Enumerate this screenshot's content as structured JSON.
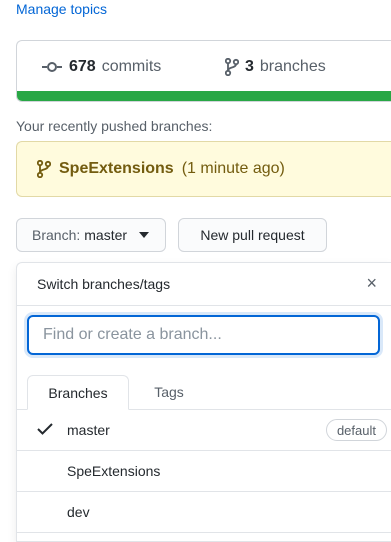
{
  "top_link": "Manage topics",
  "summary": {
    "commits_count": "678",
    "commits_label": "commits",
    "branches_count": "3",
    "branches_label": "branches",
    "colors": {
      "language_bar": "#28a745"
    }
  },
  "recent": {
    "label": "Your recently pushed branches:",
    "branch_name": "SpeExtensions",
    "time_ago": "(1 minute ago)"
  },
  "actions": {
    "branch_prefix": "Branch:",
    "branch_current": "master",
    "new_pr_label": "New pull request"
  },
  "dropdown": {
    "title": "Switch branches/tags",
    "close_icon": "×",
    "filter_placeholder": "Find or create a branch...",
    "tabs": [
      {
        "label": "Branches",
        "active": true
      },
      {
        "label": "Tags",
        "active": false
      }
    ],
    "branches": [
      {
        "name": "master",
        "selected": true,
        "badge": "default"
      },
      {
        "name": "SpeExtensions",
        "selected": false
      },
      {
        "name": "dev",
        "selected": false
      }
    ]
  }
}
